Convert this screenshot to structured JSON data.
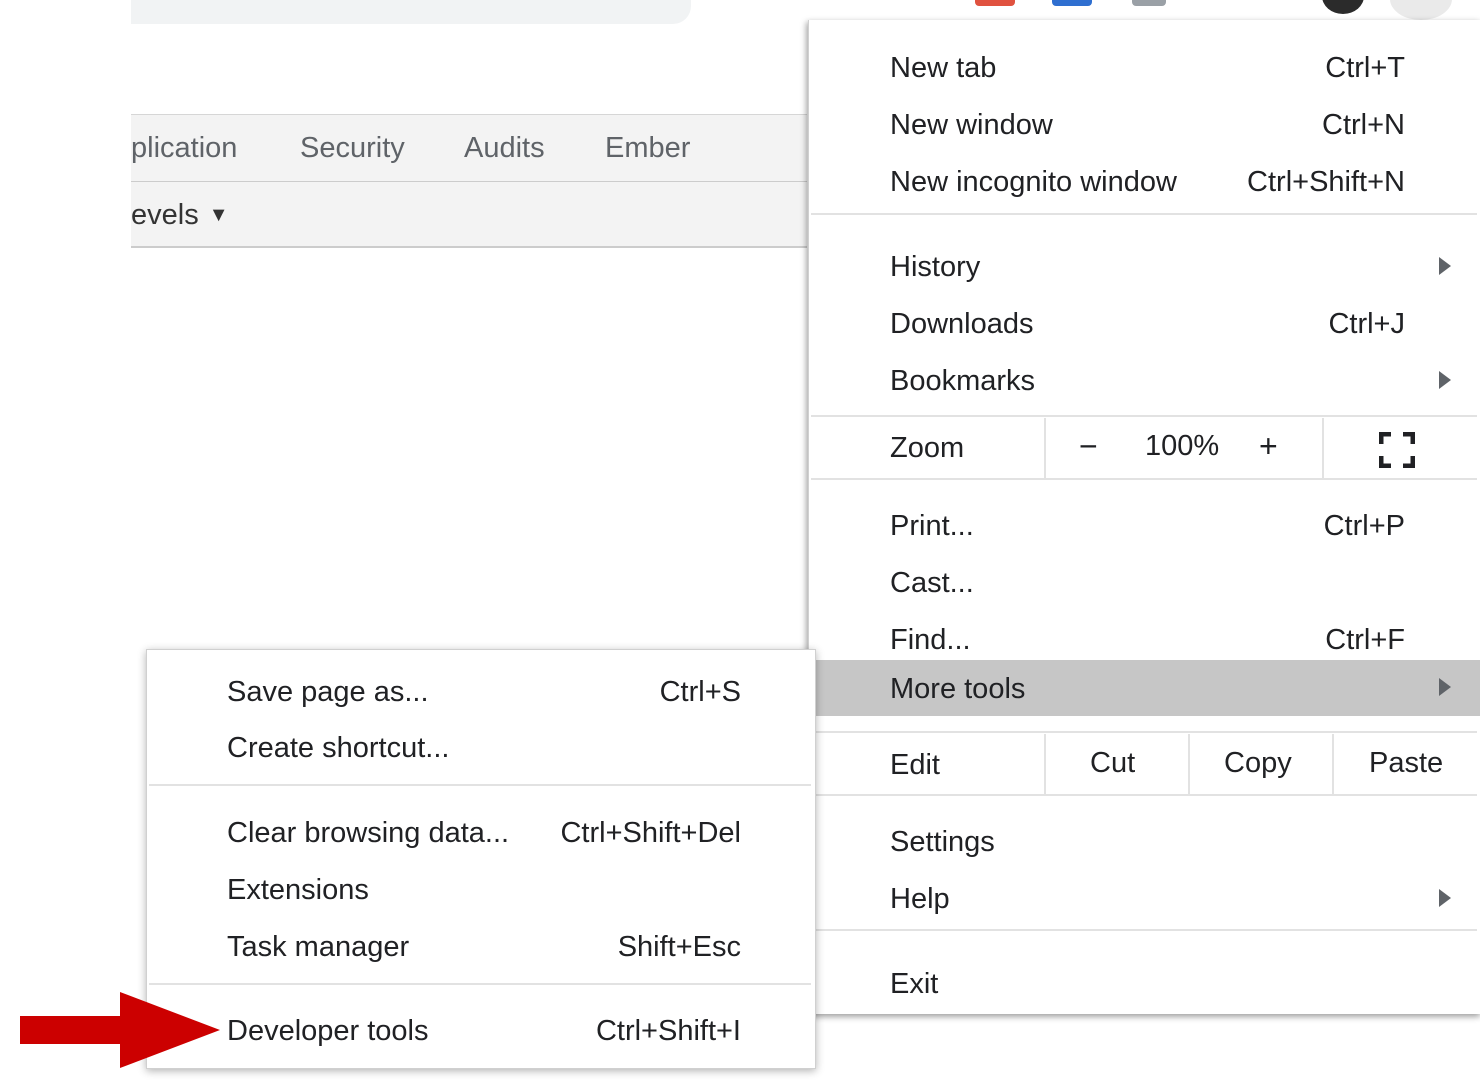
{
  "devtools": {
    "tabs": [
      "plication",
      "Security",
      "Audits",
      "Ember"
    ],
    "filter_label": "evels",
    "filter_arrow": "▼"
  },
  "main_menu": {
    "new_tab": {
      "label": "New tab",
      "shortcut": "Ctrl+T"
    },
    "new_window": {
      "label": "New window",
      "shortcut": "Ctrl+N"
    },
    "new_incognito": {
      "label": "New incognito window",
      "shortcut": "Ctrl+Shift+N"
    },
    "history": {
      "label": "History"
    },
    "downloads": {
      "label": "Downloads",
      "shortcut": "Ctrl+J"
    },
    "bookmarks": {
      "label": "Bookmarks"
    },
    "zoom": {
      "label": "Zoom",
      "minus": "−",
      "value": "100%",
      "plus": "+"
    },
    "print": {
      "label": "Print...",
      "shortcut": "Ctrl+P"
    },
    "cast": {
      "label": "Cast..."
    },
    "find": {
      "label": "Find...",
      "shortcut": "Ctrl+F"
    },
    "more_tools": {
      "label": "More tools"
    },
    "edit": {
      "label": "Edit",
      "cut": "Cut",
      "copy": "Copy",
      "paste": "Paste"
    },
    "settings": {
      "label": "Settings"
    },
    "help": {
      "label": "Help"
    },
    "exit": {
      "label": "Exit"
    }
  },
  "sub_menu": {
    "save_page": {
      "label": "Save page as...",
      "shortcut": "Ctrl+S"
    },
    "create_shortcut": {
      "label": "Create shortcut..."
    },
    "clear_browsing": {
      "label": "Clear browsing data...",
      "shortcut": "Ctrl+Shift+Del"
    },
    "extensions": {
      "label": "Extensions"
    },
    "task_manager": {
      "label": "Task manager",
      "shortcut": "Shift+Esc"
    },
    "developer_tools": {
      "label": "Developer tools",
      "shortcut": "Ctrl+Shift+I"
    }
  },
  "colors": {
    "highlight": "#c6c6c6",
    "annotation_arrow": "#cc0000"
  }
}
